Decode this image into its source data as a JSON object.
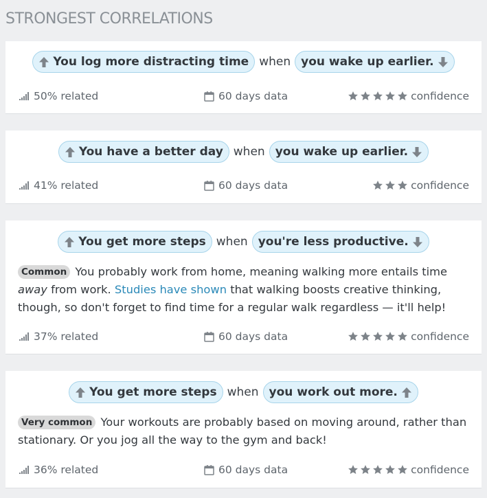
{
  "title": "STRONGEST CORRELATIONS",
  "when_label": "when",
  "cards": [
    {
      "effect": "You log more distracting time",
      "effect_dir": "up",
      "cause": "you wake up earlier.",
      "cause_dir": "down",
      "related": "50% related",
      "days": "60 days data",
      "confidence_stars": 5,
      "confidence": "confidence"
    },
    {
      "effect": "You have a better day",
      "effect_dir": "up",
      "cause": "you wake up earlier.",
      "cause_dir": "down",
      "related": "41% related",
      "days": "60 days data",
      "confidence_stars": 3,
      "confidence": "confidence"
    },
    {
      "effect": "You get more steps",
      "effect_dir": "up",
      "cause": "you're less productive.",
      "cause_dir": "down",
      "badge": "Common",
      "desc_1": "You probably work from home, meaning walking more entails time",
      "desc_em": "away",
      "desc_2": "from work.",
      "desc_link": "Studies have shown",
      "desc_3": "that walking boosts creative thinking, though, so don't forget to find time for a regular walk regardless — it'll help!",
      "related": "37% related",
      "days": "60 days data",
      "confidence_stars": 5,
      "confidence": "confidence"
    },
    {
      "effect": "You get more steps",
      "effect_dir": "up",
      "cause": "you work out more.",
      "cause_dir": "up",
      "badge": "Very common",
      "desc_1": "Your workouts are probably based on moving around, rather than stationary. Or you jog all the way to the gym and back!",
      "related": "36% related",
      "days": "60 days data",
      "confidence_stars": 5,
      "confidence": "confidence"
    }
  ],
  "colors": {
    "pill_bg": "#e0f2fb",
    "pill_border": "#a7d4ea",
    "link": "#2a89b8",
    "icon": "#7d8389",
    "page_bg": "#eeeff1"
  }
}
